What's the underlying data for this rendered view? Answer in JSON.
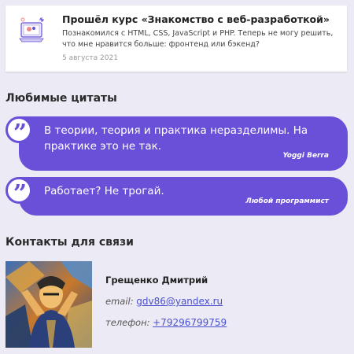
{
  "course": {
    "title": "Прошёл курс «Знакомство с веб-разработкой»",
    "text": "Познакомился с HTML, CSS, JavaScript и PHP. Теперь не могу решить, что мне нравится больше: фронтенд или бэкенд?",
    "date": "5 августа 2021"
  },
  "quotes_section": {
    "title": "Любимые цитаты",
    "quotes": [
      {
        "text": "В теории, теория и практика неразделимы. На практике это не так.",
        "author": "Yoggi Berra"
      },
      {
        "text": "Работает? Не трогай.",
        "author": "Любой программист"
      }
    ],
    "quote_mark": "”"
  },
  "contacts_section": {
    "title": "Контакты для связи",
    "name": "Грещенко Дмитрий",
    "email_label": "email:",
    "email": "gdv86@yandex.ru",
    "phone_label": "телефон:",
    "phone": "+79296799759"
  },
  "colors": {
    "accent": "#6a4fd8",
    "background": "#ecebf5",
    "link": "#4a4fd0"
  },
  "icons": [
    "course-illustration-icon",
    "quote-icon",
    "avatar"
  ]
}
